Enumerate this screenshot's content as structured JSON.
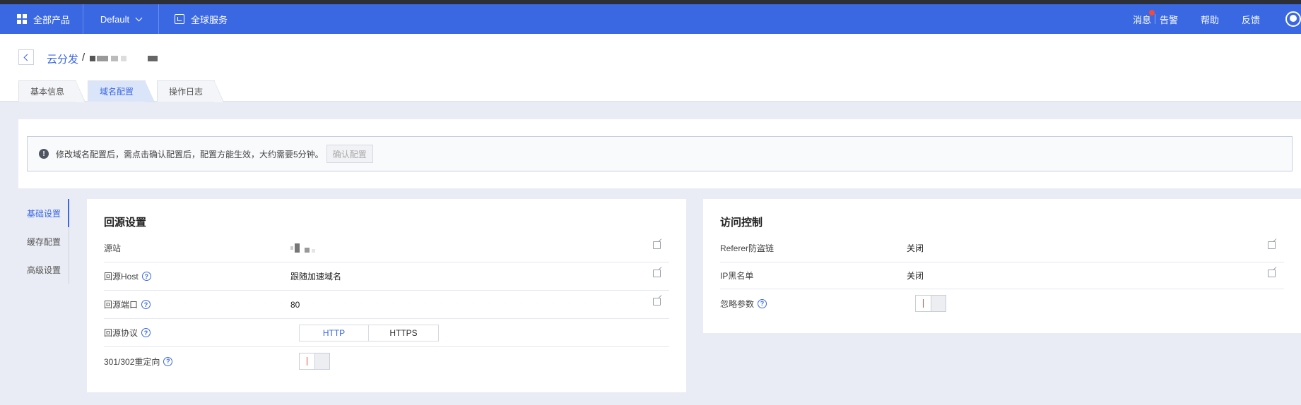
{
  "nav": {
    "all_products": "全部产品",
    "project": "Default",
    "global_services": "全球服务",
    "messages": "消息",
    "alarm": "告警",
    "help": "帮助",
    "feedback": "反馈",
    "brand_color": "#3a68e3",
    "unread_dot_color": "#f24a3c"
  },
  "breadcrumb": {
    "root": "云分发",
    "separator": "/"
  },
  "tabs": [
    {
      "label": "基本信息",
      "active": false
    },
    {
      "label": "域名配置",
      "active": true
    },
    {
      "label": "操作日志",
      "active": false
    }
  ],
  "notice": {
    "icon": "info-icon",
    "text": "修改域名配置后，需点击确认配置后，配置方能生效，大约需要5分钟。",
    "confirm_button": "确认配置"
  },
  "sidenav": [
    {
      "label": "基础设置",
      "active": true
    },
    {
      "label": "缓存配置",
      "active": false
    },
    {
      "label": "高级设置",
      "active": false
    }
  ],
  "origin_panel": {
    "title": "回源设置",
    "rows": {
      "origin": {
        "label": "源站"
      },
      "host": {
        "label": "回源Host",
        "value": "跟随加速域名"
      },
      "port": {
        "label": "回源端口",
        "value": "80"
      },
      "protocol": {
        "label": "回源协议",
        "options": [
          "HTTP",
          "HTTPS"
        ],
        "selected": "HTTP"
      },
      "redirect": {
        "label": "301/302重定向",
        "enabled": false
      }
    }
  },
  "access_panel": {
    "title": "访问控制",
    "rows": {
      "referer": {
        "label": "Referer防盗链",
        "value": "关闭"
      },
      "ip_blacklist": {
        "label": "IP黑名单",
        "value": "关闭"
      },
      "ignore_params": {
        "label": "忽略参数",
        "enabled": false
      }
    }
  }
}
